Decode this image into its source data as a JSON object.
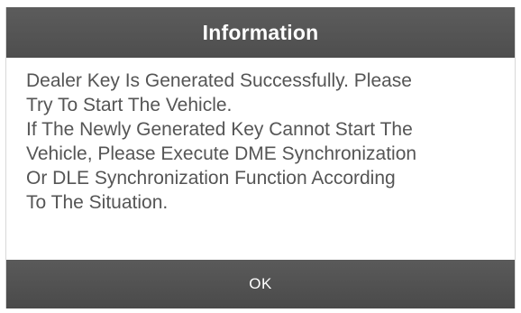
{
  "dialog": {
    "title": "Information",
    "message": "Dealer Key Is Generated Successfully. Please\nTry To Start The Vehicle.\nIf The Newly Generated Key Cannot Start The\nVehicle, Please Execute DME Synchronization\nOr DLE Synchronization Function According\nTo The Situation.",
    "ok_label": "OK"
  }
}
